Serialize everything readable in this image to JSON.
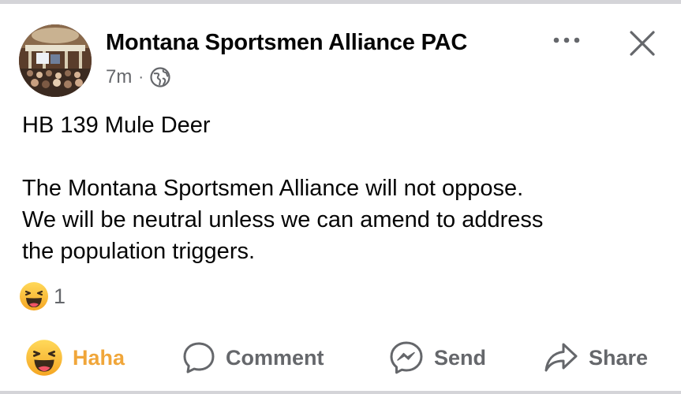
{
  "post": {
    "author": "Montana Sportsmen Alliance PAC",
    "time": "7m",
    "separator": "·",
    "privacy_icon": "globe-icon",
    "title": "HB 139 Mule Deer",
    "body_lines": [
      "The Montana Sportsmen Alliance will not oppose.",
      "We will be neutral unless we can amend to address",
      "the population triggers."
    ]
  },
  "header": {
    "more_icon": "more-icon",
    "close_icon": "close-icon"
  },
  "reactions": {
    "icon": "haha-emoji-icon",
    "count": "1"
  },
  "actions": {
    "haha_label": "Haha",
    "comment_label": "Comment",
    "send_label": "Send",
    "share_label": "Share"
  },
  "colors": {
    "haha_accent": "#f0a63a",
    "secondary_text": "#65676b",
    "primary_text": "#050505"
  }
}
